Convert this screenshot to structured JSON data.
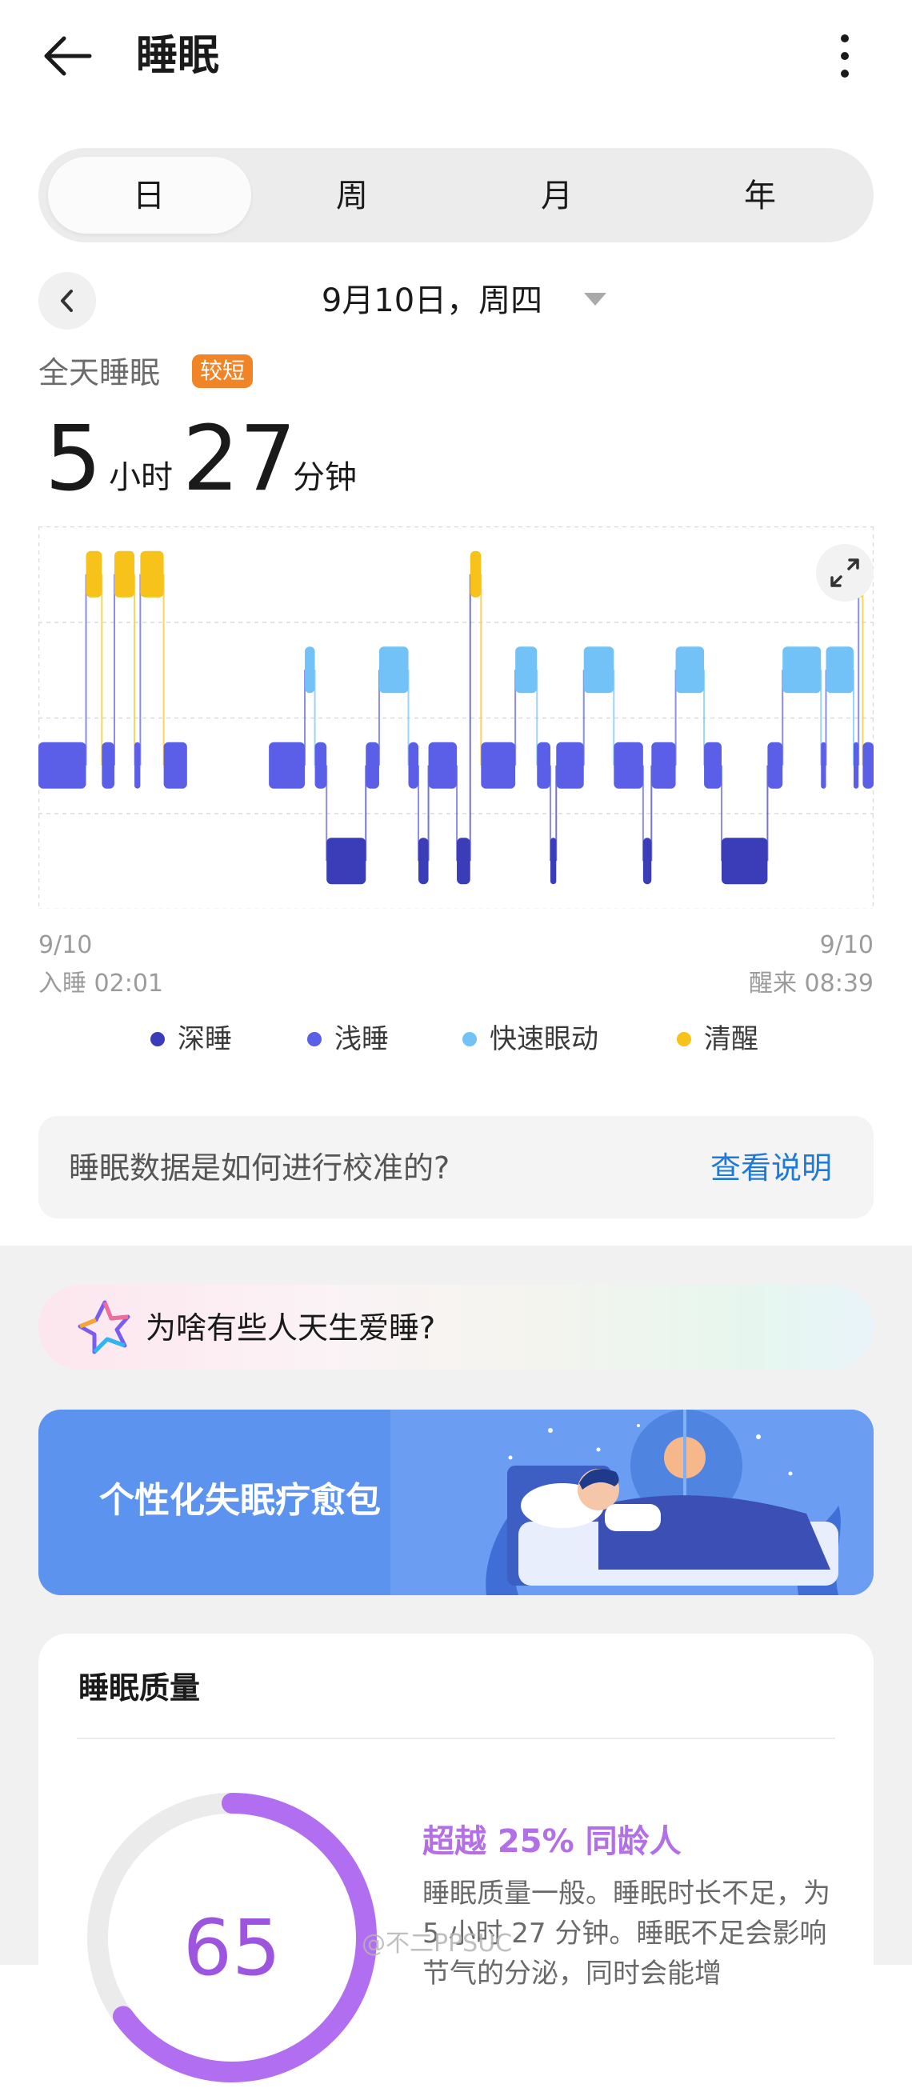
{
  "header": {
    "title": "睡眠"
  },
  "tabs": [
    {
      "label": "日",
      "selected": true
    },
    {
      "label": "周",
      "selected": false
    },
    {
      "label": "月",
      "selected": false
    },
    {
      "label": "年",
      "selected": false
    }
  ],
  "date_nav": {
    "label": "9月10日，周四"
  },
  "summary": {
    "title": "全天睡眠",
    "badge": "较短",
    "hours": "5",
    "hours_unit": "小时",
    "minutes": "27",
    "minutes_unit": "分钟"
  },
  "chart_data": {
    "type": "hypnogram",
    "stages": [
      "清醒",
      "快速眼动",
      "浅睡",
      "深睡"
    ],
    "start_label": "9/10",
    "end_label": "9/10",
    "start_time": "入睡 02:01",
    "end_time": "醒来 08:39",
    "colors": {
      "深睡": "#3b3db8",
      "浅睡": "#5b5ee6",
      "快速眼动": "#72c2f8",
      "清醒": "#f7c31a"
    },
    "segments": [
      {
        "stage": "浅睡",
        "start": 0.0,
        "end": 0.057
      },
      {
        "stage": "清醒",
        "start": 0.057,
        "end": 0.076
      },
      {
        "stage": "浅睡",
        "start": 0.076,
        "end": 0.091
      },
      {
        "stage": "清醒",
        "start": 0.091,
        "end": 0.115
      },
      {
        "stage": "浅睡",
        "start": 0.115,
        "end": 0.122
      },
      {
        "stage": "清醒",
        "start": 0.122,
        "end": 0.15
      },
      {
        "stage": "浅睡",
        "start": 0.15,
        "end": 0.178
      },
      {
        "stage": "浅睡",
        "start": 0.276,
        "end": 0.319
      },
      {
        "stage": "快速眼动",
        "start": 0.319,
        "end": 0.331
      },
      {
        "stage": "浅睡",
        "start": 0.331,
        "end": 0.345
      },
      {
        "stage": "深睡",
        "start": 0.345,
        "end": 0.392
      },
      {
        "stage": "浅睡",
        "start": 0.392,
        "end": 0.408
      },
      {
        "stage": "快速眼动",
        "start": 0.408,
        "end": 0.443
      },
      {
        "stage": "浅睡",
        "start": 0.443,
        "end": 0.455
      },
      {
        "stage": "深睡",
        "start": 0.455,
        "end": 0.467
      },
      {
        "stage": "浅睡",
        "start": 0.467,
        "end": 0.501
      },
      {
        "stage": "深睡",
        "start": 0.501,
        "end": 0.517
      },
      {
        "stage": "清醒",
        "start": 0.517,
        "end": 0.53
      },
      {
        "stage": "浅睡",
        "start": 0.53,
        "end": 0.571
      },
      {
        "stage": "快速眼动",
        "start": 0.571,
        "end": 0.597
      },
      {
        "stage": "浅睡",
        "start": 0.597,
        "end": 0.613
      },
      {
        "stage": "深睡",
        "start": 0.613,
        "end": 0.62
      },
      {
        "stage": "浅睡",
        "start": 0.62,
        "end": 0.653
      },
      {
        "stage": "快速眼动",
        "start": 0.653,
        "end": 0.689
      },
      {
        "stage": "浅睡",
        "start": 0.689,
        "end": 0.724
      },
      {
        "stage": "深睡",
        "start": 0.724,
        "end": 0.734
      },
      {
        "stage": "浅睡",
        "start": 0.734,
        "end": 0.763
      },
      {
        "stage": "快速眼动",
        "start": 0.763,
        "end": 0.797
      },
      {
        "stage": "浅睡",
        "start": 0.797,
        "end": 0.818
      },
      {
        "stage": "深睡",
        "start": 0.818,
        "end": 0.873
      },
      {
        "stage": "浅睡",
        "start": 0.873,
        "end": 0.891
      },
      {
        "stage": "快速眼动",
        "start": 0.891,
        "end": 0.937
      },
      {
        "stage": "浅睡",
        "start": 0.937,
        "end": 0.943
      },
      {
        "stage": "快速眼动",
        "start": 0.943,
        "end": 0.976
      },
      {
        "stage": "浅睡",
        "start": 0.976,
        "end": 0.982
      },
      {
        "stage": "清醒",
        "start": 0.982,
        "end": 0.987
      },
      {
        "stage": "浅睡",
        "start": 0.987,
        "end": 1.0
      }
    ],
    "legend": [
      {
        "name": "深睡",
        "color": "#3b3db8"
      },
      {
        "name": "浅睡",
        "color": "#5b5ee6"
      },
      {
        "name": "快速眼动",
        "color": "#72c2f8"
      },
      {
        "name": "清醒",
        "color": "#f7c31a"
      }
    ]
  },
  "calibration": {
    "question": "睡眠数据是如何进行校准的?",
    "link": "查看说明"
  },
  "ai_prompt": {
    "text": "为啥有些人天生爱睡?"
  },
  "banner": {
    "text": "个性化失眠疗愈包"
  },
  "quality": {
    "title": "睡眠质量",
    "score": "65",
    "score_percent": 65,
    "beat": "超越 25% 同龄人",
    "desc": "睡眠质量一般。睡眠时长不足，为 5 小时 27 分钟。睡眠不足会影响节气的分泌，同时会能增",
    "accent": "#9d55e0"
  },
  "watermark": "@不二PPSUC"
}
